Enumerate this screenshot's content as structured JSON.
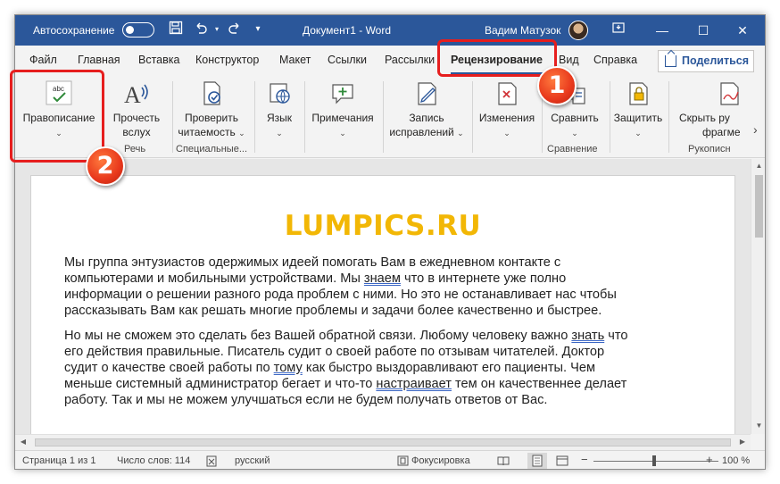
{
  "titlebar": {
    "autosave_label": "Автосохранение",
    "autosave_state": "off",
    "doc_title": "Документ1  -  Word",
    "user_name": "Вадим Матузок",
    "minimize": "—",
    "maximize": "☐",
    "close": "✕"
  },
  "tabs": [
    "Файл",
    "Главная",
    "Вставка",
    "Конструктор",
    "Макет",
    "Ссылки",
    "Рассылки",
    "Рецензирование",
    "Вид",
    "Справка"
  ],
  "active_tab": "Рецензирование",
  "share_label": "Поделиться",
  "ribbon": {
    "spelling": {
      "label": "Правописание",
      "icon_text": "abc"
    },
    "read_aloud": {
      "line1": "Прочесть",
      "line2": "вслух"
    },
    "check_readability": {
      "line1": "Проверить",
      "line2": "читаемость"
    },
    "language": {
      "label": "Язык"
    },
    "comments": {
      "label": "Примечания"
    },
    "track_changes": {
      "line1": "Запись",
      "line2": "исправлений"
    },
    "changes": {
      "label": "Изменения"
    },
    "compare": {
      "label": "Сравнить"
    },
    "protect": {
      "label": "Защитить"
    },
    "hide_ink": {
      "line1": "Скрыть ру",
      "line2": "фрагме"
    },
    "groups": {
      "speech": "Речь",
      "special": "Специальные...",
      "compare": "Сравнение",
      "ink": "Рукописн"
    }
  },
  "document": {
    "heading": "LUMPICS.RU",
    "paragraph1": [
      {
        "t": "Мы группа энтузиастов одержимых идеей помогать Вам в ежедневном контакте с"
      },
      {
        "t": "компьютерами и мобильными устройствами. Мы "
      },
      {
        "t": "знаем",
        "u": true
      },
      {
        "t": " что в интернете уже полно"
      },
      {
        "t": "информации о решении разного рода проблем с ними. Но это не останавливает нас чтобы"
      },
      {
        "t": "рассказывать Вам как решать многие проблемы и задачи более качественно и быстрее."
      }
    ],
    "paragraph1_lines": [
      "Мы группа энтузиастов одержимых идеей помогать Вам в ежедневном контакте с",
      "компьютерами и мобильными устройствами. Мы ",
      "знаем",
      " что в интернете уже полно",
      "информации о решении разного рода проблем с ними. Но это не останавливает нас чтобы",
      "рассказывать Вам как решать многие проблемы и задачи более качественно и быстрее."
    ],
    "paragraph2_lines": [
      "Но мы не сможем это сделать без Вашей обратной связи. Любому человеку важно ",
      "знать",
      " что",
      "его действия правильные. Писатель судит о своей работе по отзывам читателей. Доктор",
      "судит о качестве своей работы по ",
      "тому",
      " как быстро выздоравливают его пациенты. Чем",
      "меньше системный администратор бегает и что-то ",
      "настраивает",
      " тем он качественнее делает",
      "работу. Так и мы не можем улучшаться если не будем получать ответов от Вас."
    ]
  },
  "statusbar": {
    "page": "Страница 1 из 1",
    "words": "Число слов: 114",
    "language": "русский",
    "focus": "Фокусировка",
    "zoom_minus": "−",
    "zoom_plus": "+",
    "zoom": "100 %",
    "zoom_level_percent": 100
  },
  "callouts": {
    "one": "1",
    "two": "2",
    "color": "#e61e1e"
  },
  "colors": {
    "titlebar": "#2b579a",
    "heading": "#f2b705",
    "underline": "#3b66c4"
  }
}
